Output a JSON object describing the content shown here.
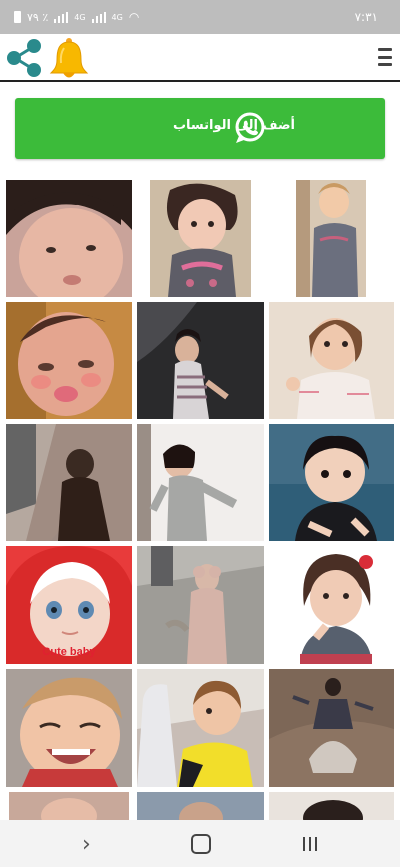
{
  "status_bar": {
    "battery_percent": "٧٩ ٪",
    "network_1": "4G",
    "network_2": "4G",
    "time": "٧:٣١"
  },
  "app_bar": {
    "icons": [
      "share-icon",
      "bell-icon",
      "menu-icon"
    ]
  },
  "whatsapp_button": {
    "label": "أضف إلى الواتساب",
    "icon": "whatsapp-icon",
    "color": "#3cbb3a"
  },
  "stickers": [
    {
      "name": "sticker-1"
    },
    {
      "name": "sticker-2"
    },
    {
      "name": "sticker-3"
    },
    {
      "name": "sticker-4"
    },
    {
      "name": "sticker-5"
    },
    {
      "name": "sticker-6"
    },
    {
      "name": "sticker-7"
    },
    {
      "name": "sticker-8"
    },
    {
      "name": "sticker-9"
    },
    {
      "name": "sticker-10",
      "caption": "Cute baby"
    },
    {
      "name": "sticker-11"
    },
    {
      "name": "sticker-12"
    },
    {
      "name": "sticker-13"
    },
    {
      "name": "sticker-14"
    },
    {
      "name": "sticker-15"
    },
    {
      "name": "sticker-16"
    },
    {
      "name": "sticker-17"
    },
    {
      "name": "sticker-18"
    }
  ],
  "nav_bar": {
    "icons": [
      "back-icon",
      "home-icon",
      "recents-icon"
    ]
  }
}
